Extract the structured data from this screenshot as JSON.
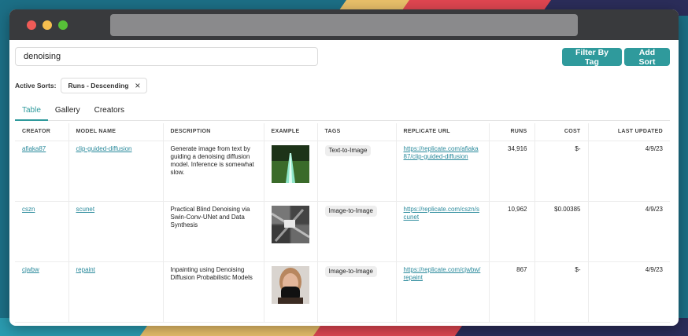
{
  "search": {
    "value": "denoising"
  },
  "buttons": {
    "filter_label": "Filter By Tag",
    "add_sort_label": "Add Sort"
  },
  "sorts": {
    "label": "Active Sorts:",
    "chips": [
      {
        "label": "Runs - Descending",
        "remove_icon": "×"
      }
    ]
  },
  "tabs": [
    {
      "label": "Table",
      "active": true
    },
    {
      "label": "Gallery"
    },
    {
      "label": "Creators"
    }
  ],
  "table": {
    "headers": [
      "CREATOR",
      "MODEL NAME",
      "DESCRIPTION",
      "EXAMPLE",
      "TAGS",
      "REPLICATE URL",
      "RUNS",
      "COST",
      "LAST UPDATED"
    ],
    "rows": [
      {
        "creator": "afiaka87",
        "model": "clip-guided-diffusion",
        "description": "Generate image from text by guiding a denoising diffusion model. Inference is somewhat slow.",
        "example_icon": "green-road-image",
        "tag": "Text-to-Image",
        "url": "https://replicate.com/afiaka87/clip-guided-diffusion",
        "runs": "34,916",
        "cost": "$-",
        "updated": "4/9/23"
      },
      {
        "creator": "cszn",
        "model": "scunet",
        "description": "Practical Blind Denoising via Swin-Conv-UNet and Data Synthesis",
        "example_icon": "grayscale-grid-image",
        "tag": "Image-to-Image",
        "url": "https://replicate.com/cszn/scunet",
        "runs": "10,962",
        "cost": "$0.00385",
        "updated": "4/9/23"
      },
      {
        "creator": "cjwbw",
        "model": "repaint",
        "description": "Inpainting using Denoising Diffusion Probabilistic Models",
        "example_icon": "masked-face-image",
        "tag": "Image-to-Image",
        "url": "https://replicate.com/cjwbw/repaint",
        "runs": "867",
        "cost": "$-",
        "updated": "4/9/23"
      }
    ]
  },
  "colors": {
    "accent": "#2f9a9c",
    "link": "#2a8a9c",
    "titlebar": "#393a3d"
  }
}
